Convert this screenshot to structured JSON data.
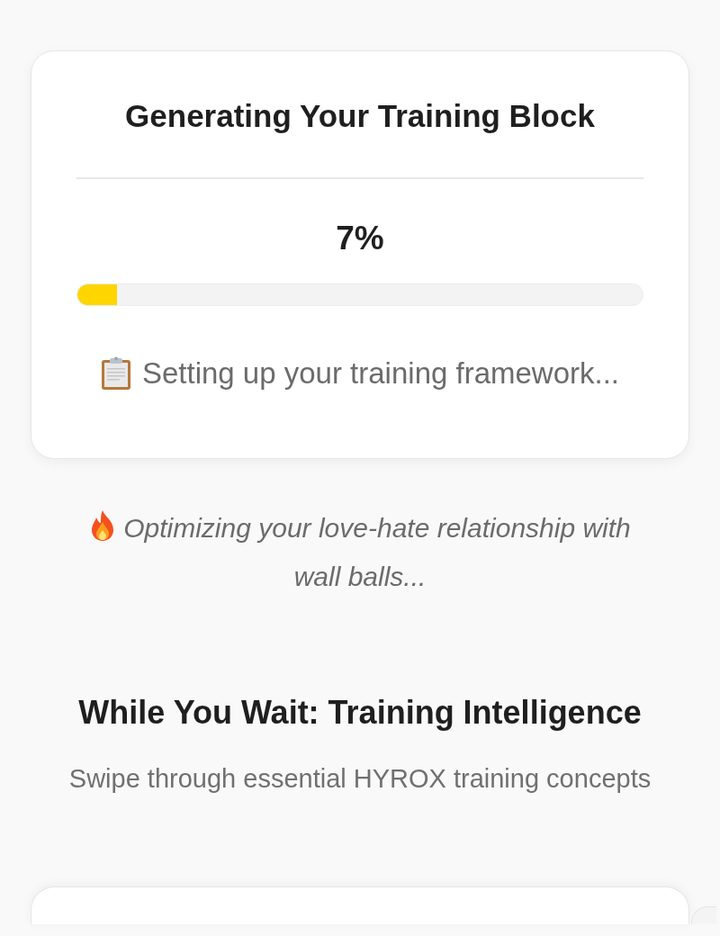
{
  "progress_card": {
    "title": "Generating Your Training Block",
    "percent": "7%",
    "level": 0.07,
    "status": "Setting up your training framework..."
  },
  "tip": "Optimizing your love-hate relationship with wall balls...",
  "section": {
    "heading": "While You Wait: Training Intelligence",
    "subheading": "Swipe through essential HYROX training concepts"
  }
}
